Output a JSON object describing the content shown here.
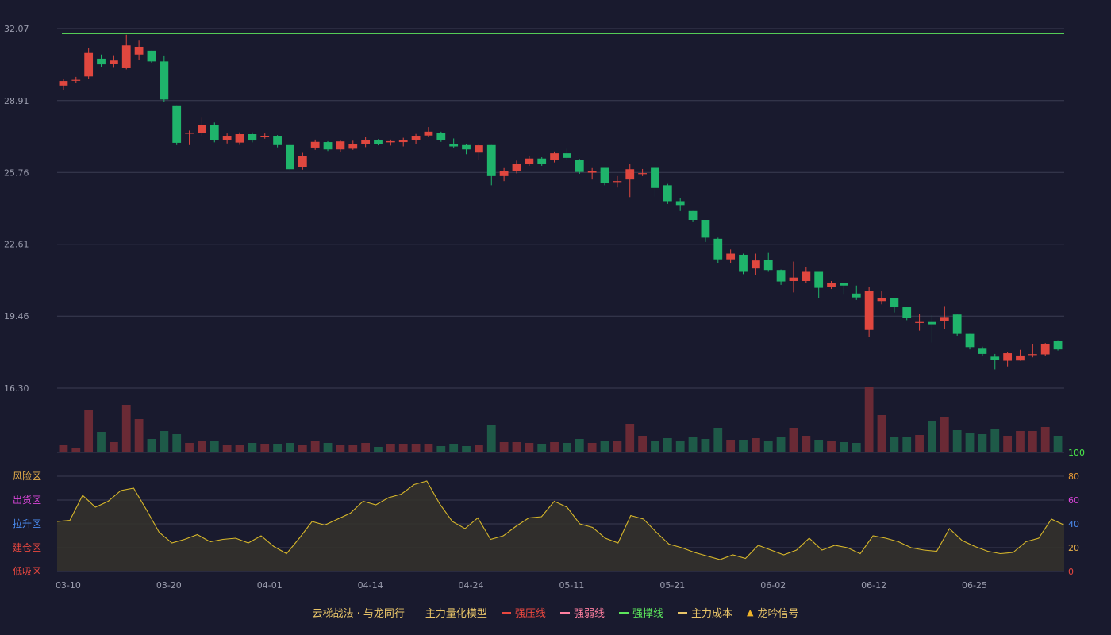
{
  "chart_data": {
    "type": "candlestick",
    "colors": {
      "up": "#e0473f",
      "down": "#1fb46b",
      "vol_up": "#6a2a35",
      "vol_down": "#1e5a48",
      "resist": "#5ce65c",
      "osc_line": "#d7b72a",
      "osc_fill": "#35322c",
      "grid": "#3a3c52",
      "axis_text": "#9a9cad"
    },
    "price_axis": {
      "ticks": [
        "32.07",
        "28.91",
        "25.76",
        "22.61",
        "19.46",
        "16.30"
      ],
      "ylim": [
        16.3,
        32.07
      ]
    },
    "x_ticks": [
      {
        "label": "03-10",
        "index": 0
      },
      {
        "label": "03-20",
        "index": 8
      },
      {
        "label": "04-01",
        "index": 16
      },
      {
        "label": "04-14",
        "index": 24
      },
      {
        "label": "04-24",
        "index": 32
      },
      {
        "label": "05-11",
        "index": 40
      },
      {
        "label": "05-21",
        "index": 48
      },
      {
        "label": "06-02",
        "index": 56
      },
      {
        "label": "06-12",
        "index": 64
      },
      {
        "label": "06-25",
        "index": 72
      }
    ],
    "resistance_line": 31.85,
    "ohlc": [
      [
        29.57,
        29.77,
        29.37,
        29.85
      ],
      [
        29.82,
        29.82,
        29.67,
        29.95
      ],
      [
        29.97,
        31.0,
        29.87,
        31.22
      ],
      [
        30.75,
        30.5,
        30.4,
        30.93
      ],
      [
        30.52,
        30.67,
        30.35,
        30.9
      ],
      [
        30.33,
        31.33,
        30.28,
        31.8
      ],
      [
        30.93,
        31.27,
        30.68,
        31.54
      ],
      [
        31.1,
        30.63,
        30.58,
        31.1
      ],
      [
        30.63,
        28.96,
        28.86,
        30.89
      ],
      [
        28.7,
        27.06,
        26.96,
        28.7
      ],
      [
        27.5,
        27.5,
        26.96,
        27.6
      ],
      [
        27.5,
        27.85,
        27.37,
        28.16
      ],
      [
        27.85,
        27.18,
        27.08,
        27.95
      ],
      [
        27.18,
        27.37,
        27.03,
        27.47
      ],
      [
        27.07,
        27.44,
        26.97,
        27.52
      ],
      [
        27.44,
        27.16,
        27.08,
        27.52
      ],
      [
        27.37,
        27.37,
        27.24,
        27.47
      ],
      [
        27.37,
        26.96,
        26.86,
        27.4
      ],
      [
        26.96,
        25.9,
        25.8,
        26.96
      ],
      [
        25.98,
        26.47,
        25.88,
        26.62
      ],
      [
        26.85,
        27.1,
        26.75,
        27.2
      ],
      [
        27.09,
        26.77,
        26.7,
        27.13
      ],
      [
        26.77,
        27.12,
        26.67,
        27.17
      ],
      [
        26.8,
        27.0,
        26.75,
        27.15
      ],
      [
        27.0,
        27.18,
        26.87,
        27.32
      ],
      [
        27.18,
        27.0,
        26.95,
        27.22
      ],
      [
        27.08,
        27.13,
        26.94,
        27.2
      ],
      [
        27.09,
        27.18,
        26.9,
        27.28
      ],
      [
        27.18,
        27.37,
        27.0,
        27.45
      ],
      [
        27.38,
        27.55,
        27.3,
        27.75
      ],
      [
        27.5,
        27.18,
        27.1,
        27.55
      ],
      [
        27.0,
        26.9,
        26.85,
        27.25
      ],
      [
        26.96,
        26.77,
        26.56,
        27.0
      ],
      [
        26.63,
        26.95,
        26.3,
        27.0
      ],
      [
        26.96,
        25.6,
        25.2,
        26.96
      ],
      [
        25.6,
        25.81,
        25.38,
        25.95
      ],
      [
        25.81,
        26.13,
        25.72,
        26.28
      ],
      [
        26.13,
        26.37,
        26.05,
        26.48
      ],
      [
        26.37,
        26.14,
        26.05,
        26.43
      ],
      [
        26.3,
        26.6,
        26.2,
        26.68
      ],
      [
        26.6,
        26.4,
        26.3,
        26.8
      ],
      [
        26.3,
        25.78,
        25.7,
        26.35
      ],
      [
        25.75,
        25.83,
        25.45,
        25.95
      ],
      [
        25.96,
        25.3,
        25.2,
        25.96
      ],
      [
        25.35,
        25.38,
        25.1,
        25.6
      ],
      [
        25.45,
        25.9,
        24.68,
        26.15
      ],
      [
        25.73,
        25.73,
        25.6,
        25.91
      ],
      [
        25.96,
        25.08,
        24.7,
        25.98
      ],
      [
        25.2,
        24.5,
        24.38,
        25.26
      ],
      [
        24.5,
        24.33,
        24.07,
        24.63
      ],
      [
        24.07,
        23.68,
        23.58,
        24.07
      ],
      [
        23.68,
        22.9,
        22.71,
        23.68
      ],
      [
        22.85,
        21.95,
        21.8,
        22.9
      ],
      [
        21.95,
        22.2,
        21.8,
        22.38
      ],
      [
        22.15,
        21.4,
        21.3,
        22.2
      ],
      [
        21.55,
        21.9,
        21.25,
        22.2
      ],
      [
        21.92,
        21.48,
        21.4,
        22.23
      ],
      [
        21.48,
        20.98,
        20.83,
        21.5
      ],
      [
        21.0,
        21.15,
        20.5,
        21.85
      ],
      [
        21.0,
        21.4,
        20.9,
        21.6
      ],
      [
        21.4,
        20.7,
        20.25,
        21.4
      ],
      [
        20.75,
        20.9,
        20.65,
        21.0
      ],
      [
        20.9,
        20.8,
        20.4,
        20.9
      ],
      [
        20.45,
        20.28,
        20.17,
        20.8
      ],
      [
        18.85,
        20.55,
        18.55,
        20.75
      ],
      [
        20.12,
        20.24,
        19.98,
        20.55
      ],
      [
        20.24,
        19.85,
        19.62,
        20.24
      ],
      [
        19.85,
        19.38,
        19.28,
        19.85
      ],
      [
        19.2,
        19.2,
        18.82,
        19.57
      ],
      [
        19.2,
        19.1,
        18.3,
        19.5
      ],
      [
        19.25,
        19.42,
        18.9,
        19.87
      ],
      [
        19.53,
        18.68,
        18.6,
        19.53
      ],
      [
        18.68,
        18.1,
        18.0,
        18.68
      ],
      [
        18.03,
        17.8,
        17.72,
        18.12
      ],
      [
        17.68,
        17.55,
        17.12,
        17.8
      ],
      [
        17.5,
        17.83,
        17.25,
        17.9
      ],
      [
        17.51,
        17.73,
        17.5,
        17.98
      ],
      [
        17.77,
        17.79,
        17.65,
        18.24
      ],
      [
        17.78,
        18.25,
        17.7,
        18.28
      ],
      [
        18.38,
        18.0,
        17.95,
        18.4
      ]
    ],
    "volume": [
      9,
      6,
      53,
      26,
      13,
      60,
      42,
      17,
      27,
      23,
      12,
      14,
      14,
      9,
      9,
      12,
      10,
      10,
      12,
      9,
      14,
      12,
      9,
      9,
      12,
      7,
      10,
      11,
      11,
      10,
      8,
      11,
      8,
      9,
      35,
      13,
      13,
      12,
      11,
      13,
      12,
      17,
      12,
      15,
      15,
      36,
      21,
      14,
      18,
      15,
      19,
      17,
      31,
      16,
      16,
      18,
      15,
      19,
      31,
      21,
      16,
      14,
      13,
      12,
      82,
      47,
      20,
      20,
      22,
      40,
      45,
      28,
      25,
      23,
      30,
      21,
      27,
      27,
      32,
      21
    ],
    "oscillator": {
      "right_ticks": [
        "100",
        "80",
        "60",
        "40",
        "20",
        "0"
      ],
      "left_labels": [
        "风险区",
        "出货区",
        "拉升区",
        "建仓区",
        "低吸区"
      ],
      "left_colors": [
        "#e8b04a",
        "#d845d8",
        "#4b8cf0",
        "#e8473f",
        "#e8473f"
      ],
      "right_colors": [
        "#4bea4b",
        "#e89a34",
        "#d845d8",
        "#4b8cf0",
        "#e8b04a",
        "#e8473f"
      ],
      "values": [
        42,
        43,
        64,
        54,
        59,
        68,
        70,
        52,
        33,
        24,
        27,
        31,
        25,
        27,
        28,
        24,
        30,
        21,
        15,
        28,
        42,
        39,
        44,
        49,
        59,
        56,
        62,
        65,
        73,
        76,
        57,
        42,
        36,
        45,
        27,
        30,
        38,
        45,
        46,
        59,
        54,
        40,
        37,
        28,
        24,
        47,
        44,
        33,
        23,
        20,
        16,
        13,
        10,
        14,
        11,
        22,
        18,
        14,
        18,
        28,
        18,
        22,
        20,
        15,
        30,
        28,
        25,
        20,
        18,
        17,
        36,
        26,
        21,
        17,
        15,
        16,
        25,
        28,
        44,
        39
      ]
    },
    "legend": [
      {
        "label": "云梯战法 · 与龙同行——主力量化模型",
        "kind": "text",
        "color": "#e8c468"
      },
      {
        "label": "强压线",
        "kind": "solid",
        "color": "#e8473f"
      },
      {
        "label": "强弱线",
        "kind": "dashed",
        "color": "#ff7fa0"
      },
      {
        "label": "强撑线",
        "kind": "solid",
        "color": "#5ce65c"
      },
      {
        "label": "主力成本",
        "kind": "dashed",
        "color": "#e8c468"
      },
      {
        "label": "龙吟信号",
        "kind": "triangle",
        "color": "#f0b429"
      }
    ]
  }
}
